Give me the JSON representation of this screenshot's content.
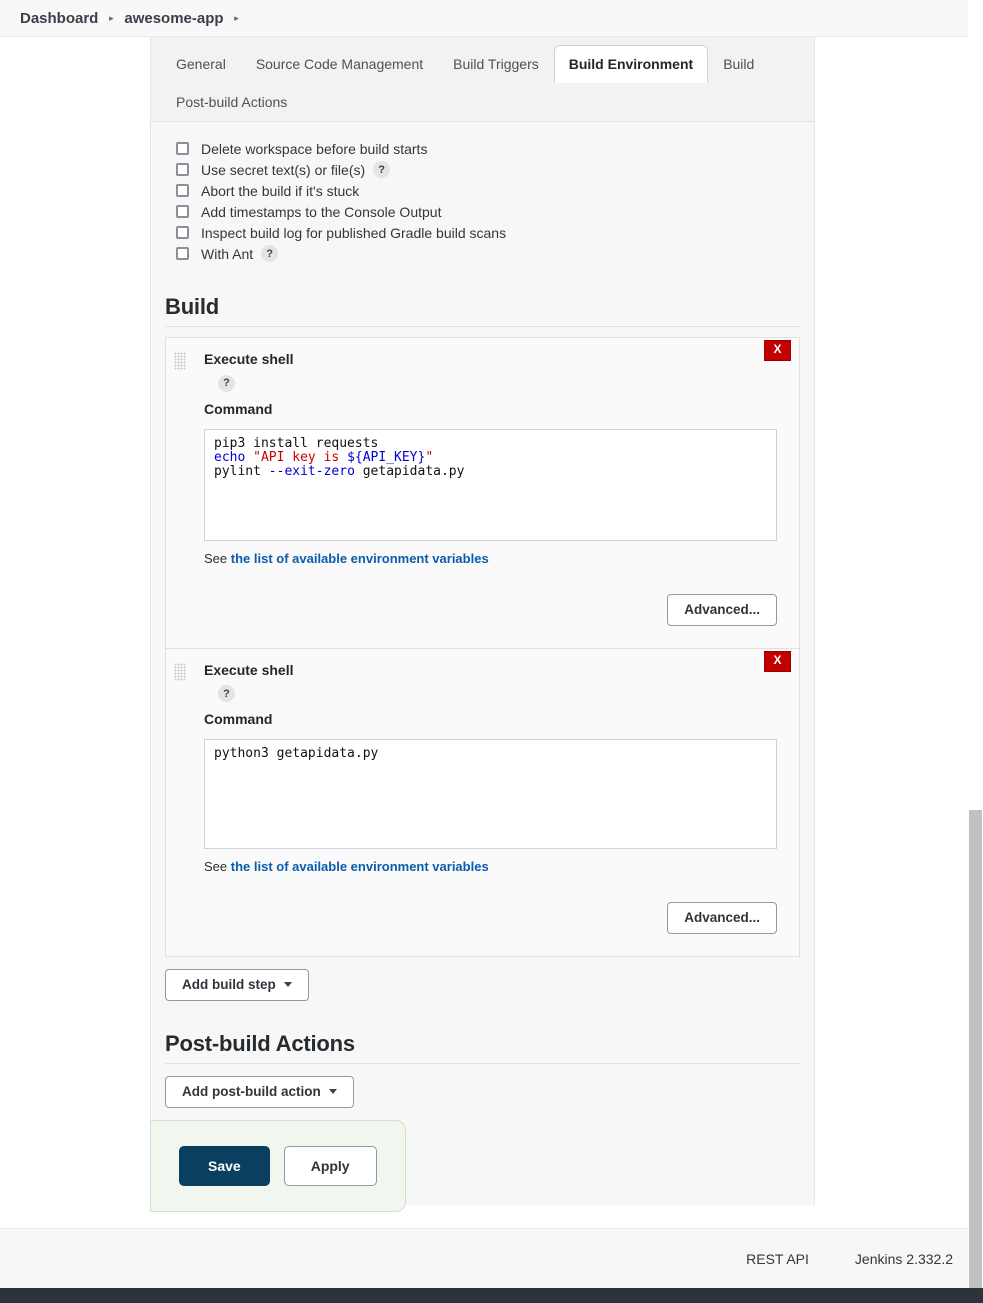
{
  "breadcrumb": {
    "items": [
      {
        "label": "Dashboard"
      },
      {
        "label": "awesome-app"
      }
    ],
    "separator": "▸"
  },
  "tabs": [
    {
      "label": "General",
      "active": false
    },
    {
      "label": "Source Code Management",
      "active": false
    },
    {
      "label": "Build Triggers",
      "active": false
    },
    {
      "label": "Build Environment",
      "active": true
    },
    {
      "label": "Build",
      "active": false
    },
    {
      "label": "Post-build Actions",
      "active": false
    }
  ],
  "build_environment": {
    "checkboxes": [
      {
        "label": "Delete workspace before build starts",
        "checked": false,
        "help": false
      },
      {
        "label": "Use secret text(s) or file(s)",
        "checked": false,
        "help": true
      },
      {
        "label": "Abort the build if it's stuck",
        "checked": false,
        "help": false
      },
      {
        "label": "Add timestamps to the Console Output",
        "checked": false,
        "help": false
      },
      {
        "label": "Inspect build log for published Gradle build scans",
        "checked": false,
        "help": false
      },
      {
        "label": "With Ant",
        "checked": false,
        "help": true
      }
    ],
    "help_glyph": "?"
  },
  "build_section": {
    "heading": "Build",
    "steps": [
      {
        "title": "Execute shell",
        "help_glyph": "?",
        "command_label": "Command",
        "command_value": "pip3 install requests\necho \"API key is ${API_KEY}\"\npylint --exit-zero getapidata.py",
        "command_tokens": [
          [
            {
              "t": "pip3 install requests",
              "c": "plain"
            }
          ],
          [
            {
              "t": "echo",
              "c": "kw"
            },
            {
              "t": " ",
              "c": "plain"
            },
            {
              "t": "\"API key is ",
              "c": "str"
            },
            {
              "t": "${API_KEY}",
              "c": "var"
            },
            {
              "t": "\"",
              "c": "str"
            }
          ],
          [
            {
              "t": "pylint ",
              "c": "plain"
            },
            {
              "t": "--exit-zero",
              "c": "opt"
            },
            {
              "t": " getapidata.py",
              "c": "plain"
            }
          ]
        ],
        "see_prefix": "See ",
        "see_link": "the list of available environment variables",
        "advanced_label": "Advanced...",
        "delete_label": "X"
      },
      {
        "title": "Execute shell",
        "help_glyph": "?",
        "command_label": "Command",
        "command_value": "python3 getapidata.py",
        "command_tokens": [
          [
            {
              "t": "python3 getapidata.py",
              "c": "plain"
            }
          ]
        ],
        "see_prefix": "See ",
        "see_link": "the list of available environment variables",
        "advanced_label": "Advanced...",
        "delete_label": "X"
      }
    ],
    "add_build_step_label": "Add build step"
  },
  "post_build_section": {
    "heading": "Post-build Actions",
    "add_post_build_action_label": "Add post-build action"
  },
  "form_actions": {
    "save_label": "Save",
    "apply_label": "Apply"
  },
  "footer": {
    "rest_api_label": "REST API",
    "version_label": "Jenkins 2.332.2"
  },
  "colors": {
    "accent_save": "#0b3f60",
    "danger": "#c30000",
    "link": "#0b5cad",
    "panel_bg": "#f7f7f7",
    "save_bar_bg": "#f1f6ef",
    "code_keyword": "#0000d0",
    "code_string": "#cc0000"
  }
}
